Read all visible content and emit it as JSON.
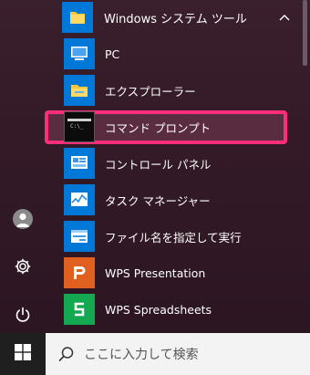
{
  "group": {
    "label": "Windows システム ツール",
    "icon": "folder-icon"
  },
  "apps": [
    {
      "label": "PC",
      "icon": "computer-icon",
      "tile_color": "#0078d7"
    },
    {
      "label": "エクスプローラー",
      "icon": "file-explorer-icon",
      "tile_color": "#0078d7"
    },
    {
      "label": "コマンド プロンプト",
      "icon": "command-prompt-icon",
      "tile_color": "#000000",
      "highlighted": true
    },
    {
      "label": "コントロール パネル",
      "icon": "control-panel-icon",
      "tile_color": "#0078d7"
    },
    {
      "label": "タスク マネージャー",
      "icon": "task-manager-icon",
      "tile_color": "#0078d7"
    },
    {
      "label": "ファイル名を指定して実行",
      "icon": "run-icon",
      "tile_color": "#0078d7"
    },
    {
      "label": "WPS Presentation",
      "icon": "wps-presentation-icon",
      "tile_color": "#e0611f"
    },
    {
      "label": "WPS Spreadsheets",
      "icon": "wps-spreadsheets-icon",
      "tile_color": "#14a850"
    }
  ],
  "rail": [
    "user-avatar",
    "settings-icon",
    "power-icon"
  ],
  "taskbar": {
    "search_placeholder": "ここに入力して検索",
    "start_icon": "windows-logo-icon"
  },
  "colors": {
    "accent": "#0078d7",
    "highlight_border": "#ff2d7a",
    "menu_bg": "#361c29",
    "taskbar_bg": "#1f1f1f",
    "search_bg": "#f3f3f3"
  }
}
